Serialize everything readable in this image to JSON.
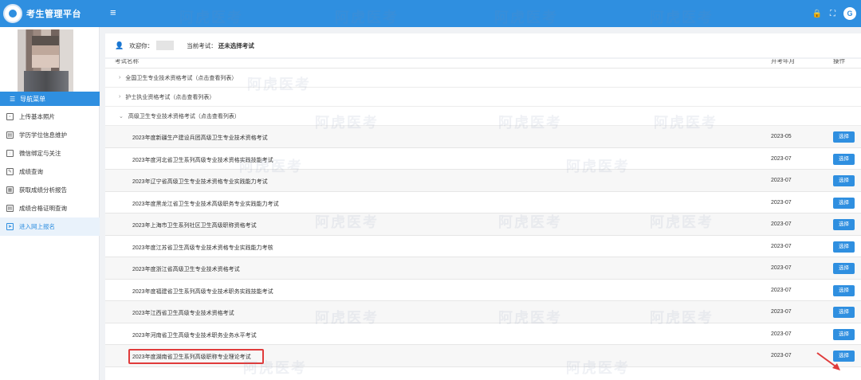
{
  "app": {
    "title": "考生管理平台"
  },
  "header": {
    "menu_icon": "hamburger-icon",
    "icons": [
      "lock-icon",
      "fullscreen-icon",
      "avatar-icon"
    ]
  },
  "sidebar": {
    "nav_header": "导航菜单",
    "items": [
      {
        "label": "上传基本照片",
        "icon": "image-icon"
      },
      {
        "label": "学历学位信息维护",
        "icon": "doc-icon"
      },
      {
        "label": "微信绑定与关注",
        "icon": "wechat-icon"
      },
      {
        "label": "成绩查询",
        "icon": "edit-icon"
      },
      {
        "label": "获取成绩分析报告",
        "icon": "report-icon"
      },
      {
        "label": "成绩合格证明查询",
        "icon": "doc-icon"
      },
      {
        "label": "进入网上报名",
        "icon": "send-icon",
        "active": true
      }
    ]
  },
  "welcome": {
    "greeting": "欢迎你：",
    "current_label": "当前考试：",
    "current_value": "还未选择考试"
  },
  "table": {
    "columns": [
      "考试名称",
      "开考年月",
      "操作"
    ],
    "groups": [
      {
        "label": "全国卫生专业技术资格考试（点击查看列表）",
        "expanded": false
      },
      {
        "label": "护士执业资格考试（点击查看列表）",
        "expanded": false
      },
      {
        "label": "高级卫生专业技术资格考试（点击查看列表）",
        "expanded": true
      }
    ],
    "rows": [
      {
        "name": "2023年度新疆生产建设兵团高级卫生专业技术资格考试",
        "month": "2023-05",
        "action": "选择"
      },
      {
        "name": "2023年度河北省卫生系列高级专业技术资格实践技能考试",
        "month": "2023-07",
        "action": "选择"
      },
      {
        "name": "2023年辽宁省高级卫生专业技术资格专业实践能力考试",
        "month": "2023-07",
        "action": "选择"
      },
      {
        "name": "2023年度黑龙江省卫生专业技术高级职务专业实践能力考试",
        "month": "2023-07",
        "action": "选择"
      },
      {
        "name": "2023年上海市卫生系列社区卫生高级职称资格考试",
        "month": "2023-07",
        "action": "选择"
      },
      {
        "name": "2023年度江苏省卫生高级专业技术资格专业实践能力考核",
        "month": "2023-07",
        "action": "选择"
      },
      {
        "name": "2023年度浙江省高级卫生专业技术资格考试",
        "month": "2023-07",
        "action": "选择"
      },
      {
        "name": "2023年度福建省卫生系列高级专业技术职务实践技能考试",
        "month": "2023-07",
        "action": "选择"
      },
      {
        "name": "2023年江西省卫生高级专业技术资格考试",
        "month": "2023-07",
        "action": "选择"
      },
      {
        "name": "2023年河南省卫生高级专业技术职务业务水平考试",
        "month": "2023-07",
        "action": "选择"
      },
      {
        "name": "2023年度湖南省卫生系列高级职称专业理论考试",
        "month": "2023-07",
        "action": "选择",
        "highlighted": true
      }
    ]
  },
  "watermark": "阿虎医考",
  "colors": {
    "primary": "#2f8fe0",
    "highlight": "#e03b3b"
  }
}
